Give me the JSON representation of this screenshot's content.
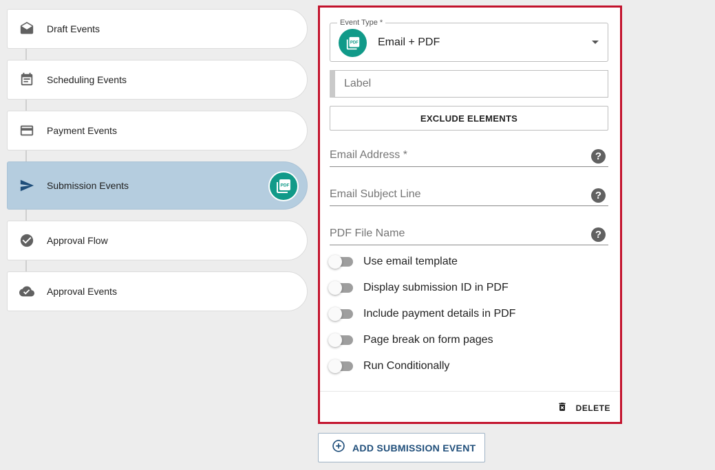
{
  "timeline": {
    "steps": [
      {
        "label": "Draft Events",
        "icon": "envelope-open-icon"
      },
      {
        "label": "Scheduling Events",
        "icon": "calendar-icon"
      },
      {
        "label": "Payment Events",
        "icon": "credit-card-icon"
      },
      {
        "label": "Submission Events",
        "icon": "send-icon",
        "active": true,
        "badge_icon": "pdf-icon"
      },
      {
        "label": "Approval Flow",
        "icon": "check-circle-icon"
      },
      {
        "label": "Approval Events",
        "icon": "cloud-check-icon"
      }
    ]
  },
  "event_card": {
    "event_type": {
      "legend": "Event Type *",
      "value": "Email + PDF",
      "icon": "pdf-icon"
    },
    "label_field": {
      "placeholder": "Label"
    },
    "exclude_button": "EXCLUDE ELEMENTS",
    "fields": [
      {
        "placeholder": "Email Address *"
      },
      {
        "placeholder": "Email Subject Line"
      },
      {
        "placeholder": "PDF File Name"
      }
    ],
    "toggles": [
      {
        "label": "Use email template",
        "on": false
      },
      {
        "label": "Display submission ID in PDF",
        "on": false
      },
      {
        "label": "Include payment details in PDF",
        "on": false
      },
      {
        "label": "Page break on form pages",
        "on": false
      },
      {
        "label": "Run Conditionally",
        "on": false
      }
    ],
    "delete_label": "DELETE"
  },
  "add_button": "ADD SUBMISSION EVENT",
  "colors": {
    "accent_teal": "#119a89",
    "active_step": "#b5cddf",
    "highlight_border": "#c2122c",
    "primary_blue": "#1f4e7a"
  }
}
